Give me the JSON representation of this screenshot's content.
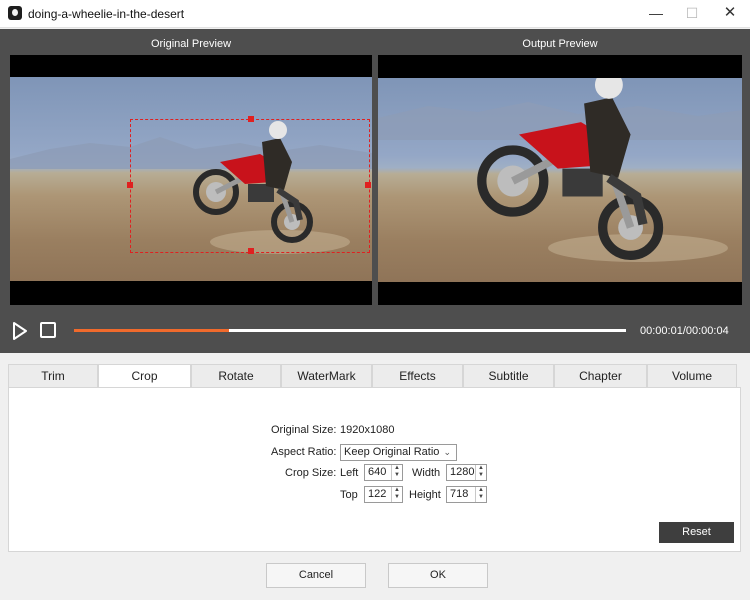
{
  "window": {
    "title": "doing-a-wheelie-in-the-desert",
    "minimize_glyph": "—",
    "maximize_glyph": "☐",
    "close_glyph": "✕"
  },
  "preview": {
    "original_label": "Original Preview",
    "output_label": "Output Preview"
  },
  "player": {
    "time": "00:00:01/00:00:04",
    "progress": 0.28,
    "accent_color": "#f06a2c"
  },
  "tabs": [
    {
      "label": "Trim"
    },
    {
      "label": "Crop"
    },
    {
      "label": "Rotate"
    },
    {
      "label": "WaterMark"
    },
    {
      "label": "Effects"
    },
    {
      "label": "Subtitle"
    },
    {
      "label": "Chapter"
    },
    {
      "label": "Volume"
    }
  ],
  "active_tab": "Crop",
  "crop": {
    "original_size_label": "Original Size:",
    "original_size_value": "1920x1080",
    "aspect_ratio_label": "Aspect Ratio:",
    "aspect_ratio_value": "Keep Original Ratio",
    "crop_size_label": "Crop Size:",
    "left_label": "Left",
    "left_value": "640",
    "width_label": "Width",
    "width_value": "1280",
    "top_label": "Top",
    "top_value": "122",
    "height_label": "Height",
    "height_value": "718",
    "reset_label": "Reset"
  },
  "footer": {
    "cancel_label": "Cancel",
    "ok_label": "OK"
  }
}
